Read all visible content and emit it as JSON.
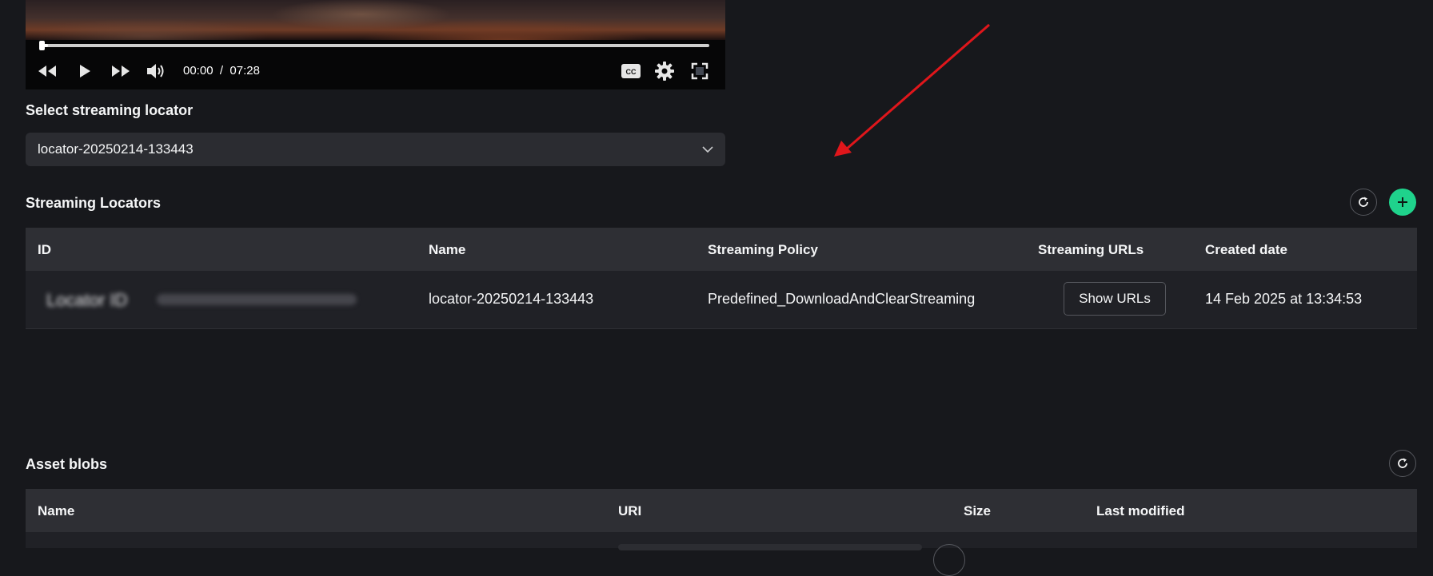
{
  "player": {
    "current_time": "00:00",
    "separator": "/",
    "duration": "07:28",
    "progress": 0.01,
    "icons": [
      "rewind-icon",
      "play-icon",
      "fast-forward-icon",
      "volume-icon",
      "captions-icon",
      "settings-gear-icon",
      "fullscreen-icon"
    ]
  },
  "locator_select": {
    "label": "Select streaming locator",
    "selected": "locator-20250214-133443"
  },
  "streaming_locators": {
    "title": "Streaming Locators",
    "columns": [
      "ID",
      "Name",
      "Streaming Policy",
      "Streaming URLs",
      "Created date"
    ],
    "rows": [
      {
        "id": "Locator ID",
        "name": "locator-20250214-133443",
        "policy": "Predefined_DownloadAndClearStreaming",
        "urls_button": "Show URLs",
        "created": "14 Feb 2025 at 13:34:53"
      }
    ]
  },
  "asset_blobs": {
    "title": "Asset blobs",
    "columns": [
      "Name",
      "URI",
      "Size",
      "Last modified"
    ]
  },
  "colors": {
    "background": "#17181c",
    "header_row": "#2e2f34",
    "accent_green": "#1fd38c",
    "annotation_arrow": "#e0161b"
  }
}
